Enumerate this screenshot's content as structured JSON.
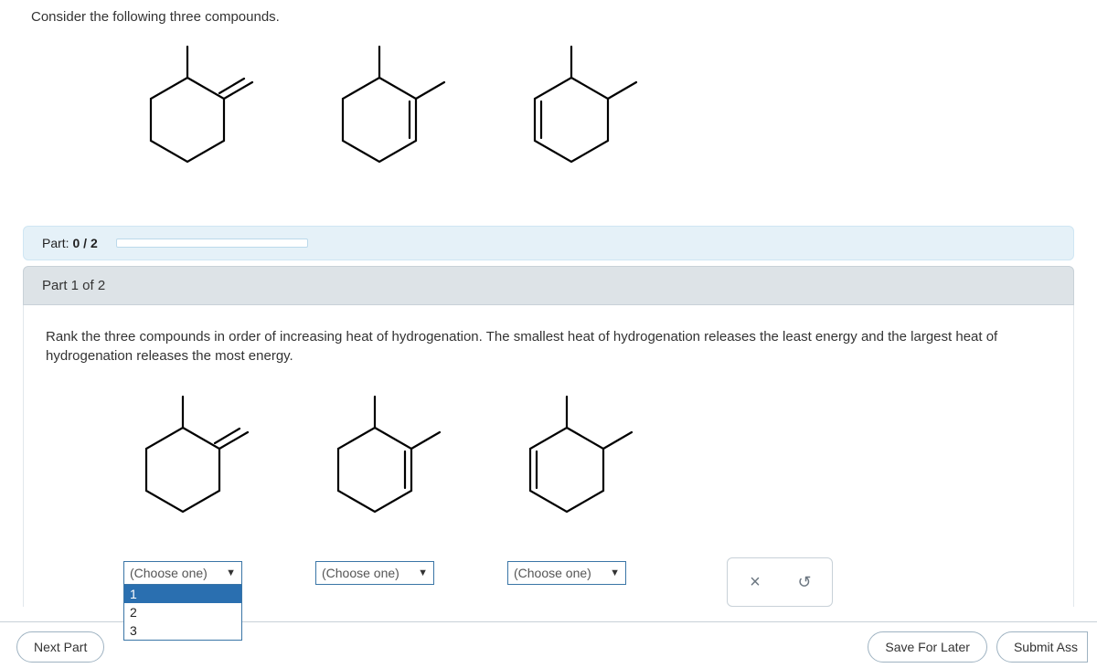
{
  "stem": "Consider the following three compounds.",
  "progress": {
    "label_prefix": "Part: ",
    "done": "0",
    "sep": " / ",
    "total": "2"
  },
  "part_header": "Part 1 of 2",
  "prompt": "Rank the three compounds in order of increasing heat of hydrogenation. The smallest heat of hydrogenation releases the least energy and the largest heat of hydrogenation releases the most energy.",
  "select": {
    "placeholder": "(Choose one)",
    "options": [
      "1",
      "2",
      "3"
    ]
  },
  "footer": {
    "next": "Next Part",
    "save": "Save For Later",
    "submit": "Submit Ass"
  },
  "icons": {
    "close": "×",
    "reset": "↺",
    "caret": "▼"
  }
}
